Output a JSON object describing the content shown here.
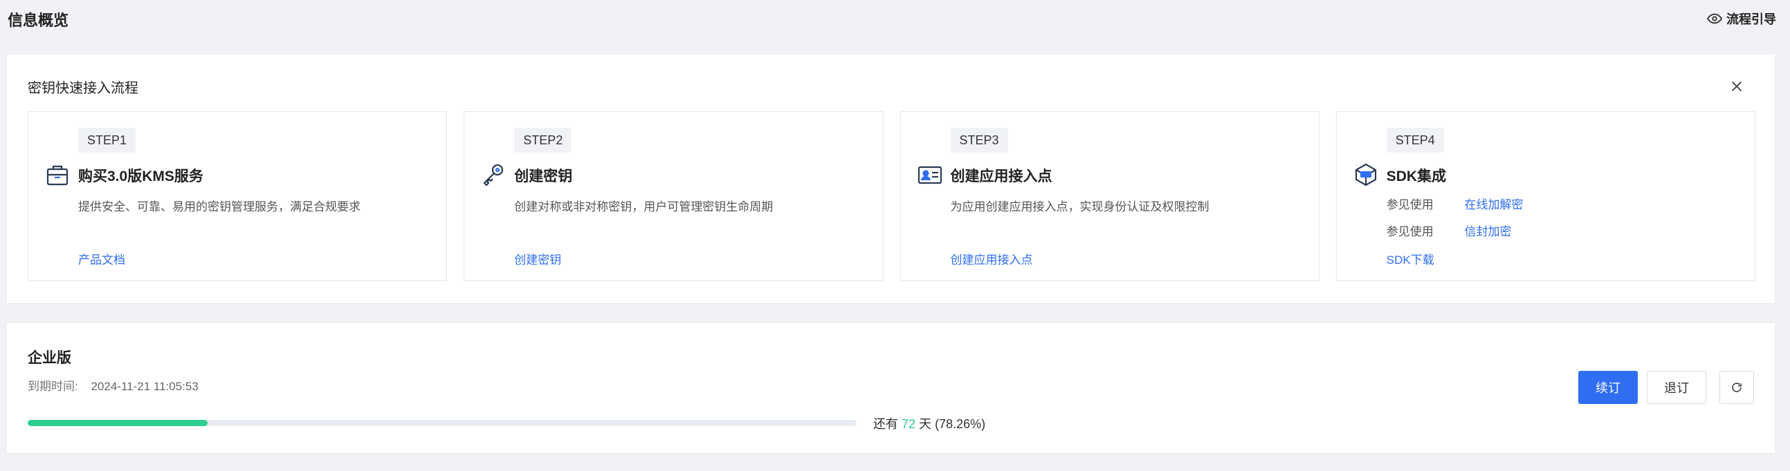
{
  "header": {
    "title": "信息概览",
    "guide_label": "流程引导"
  },
  "flow": {
    "title": "密钥快速接入流程",
    "steps": [
      {
        "badge": "STEP1",
        "name": "购买3.0版KMS服务",
        "desc": "提供安全、可靠、易用的密钥管理服务，满足合规要求",
        "link": "产品文档",
        "icon": "shopping-bag-icon"
      },
      {
        "badge": "STEP2",
        "name": "创建密钥",
        "desc": "创建对称或非对称密钥，用户可管理密钥生命周期",
        "link": "创建密钥",
        "icon": "key-icon"
      },
      {
        "badge": "STEP3",
        "name": "创建应用接入点",
        "desc": "为应用创建应用接入点，实现身份认证及权限控制",
        "link": "创建应用接入点",
        "icon": "id-card-icon"
      },
      {
        "badge": "STEP4",
        "name": "SDK集成",
        "rows": [
          {
            "prefix": "参见使用",
            "link": "在线加解密"
          },
          {
            "prefix": "参见使用",
            "link": "信封加密"
          }
        ],
        "link": "SDK下载",
        "icon": "package-icon"
      }
    ]
  },
  "plan": {
    "name": "企业版",
    "expiry_label": "到期时间:",
    "expiry_value": "2024-11-21 11:05:53",
    "progress_percent": 21.74,
    "remain_prefix": "还有",
    "remain_days": "72",
    "remain_suffix": "天 (78.26%)",
    "renew_label": "续订",
    "unsubscribe_label": "退订"
  },
  "colors": {
    "primary": "#2f6ef0",
    "progress": "#2ecc8f",
    "background": "#f0f2f5"
  }
}
